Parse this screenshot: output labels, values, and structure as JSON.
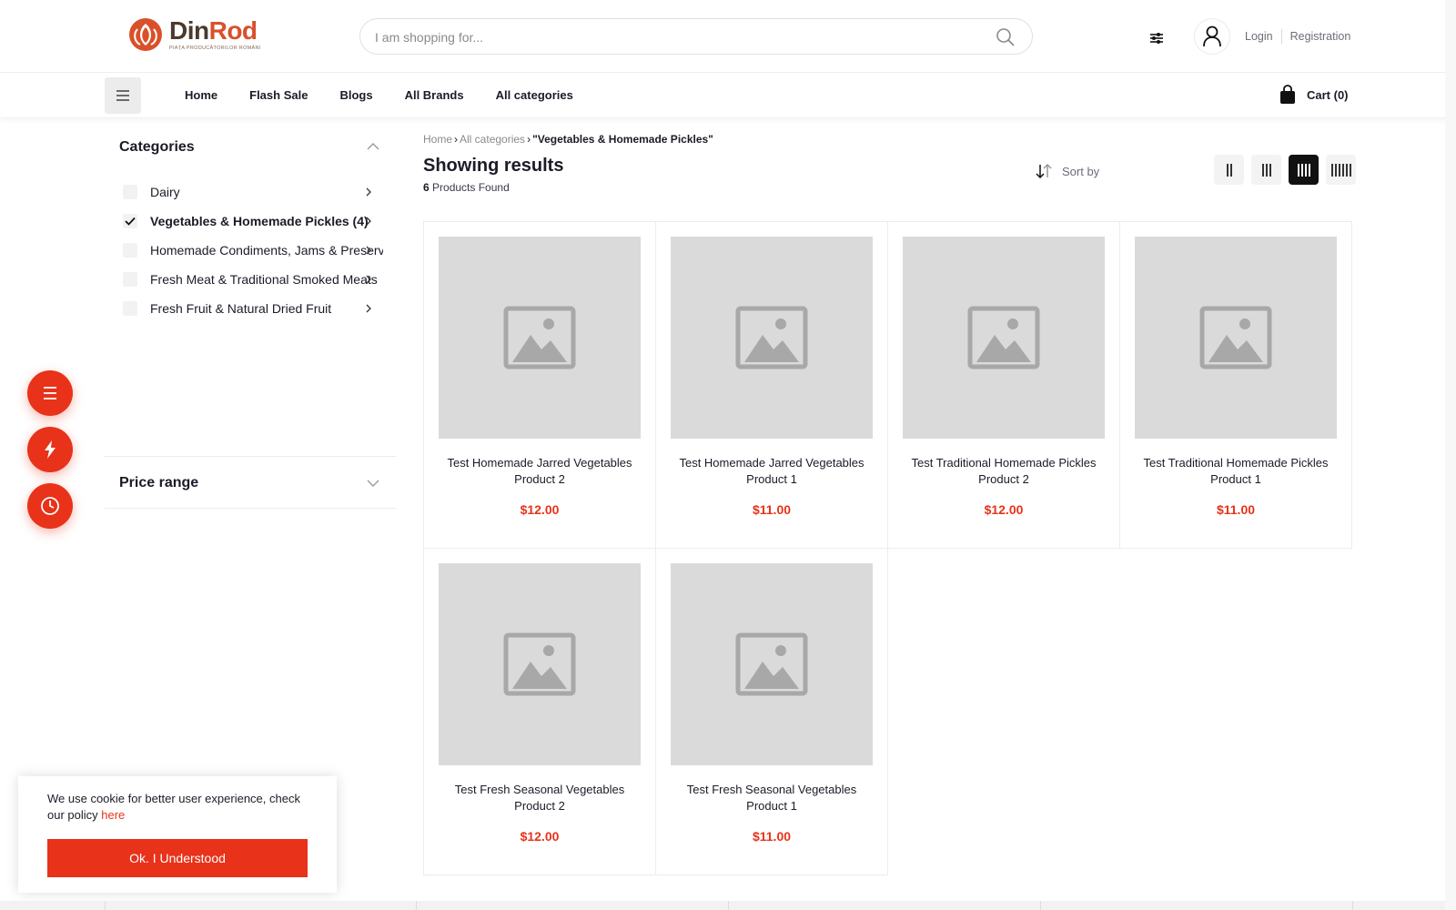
{
  "header": {
    "brand_name_a": "Din",
    "brand_name_b": "Rod",
    "brand_tagline": "PIAȚA PRODUCĂTORILOR ROMÂNI",
    "search_placeholder": "I am shopping for...",
    "login_label": "Login",
    "registration_label": "Registration"
  },
  "nav": {
    "links": [
      "Home",
      "Flash Sale",
      "Blogs",
      "All Brands",
      "All categories"
    ],
    "cart_label": "Cart (0)"
  },
  "sidebar": {
    "categories_title": "Categories",
    "categories": [
      {
        "label": "Dairy",
        "checked": false
      },
      {
        "label": "Vegetables & Homemade Pickles (4)",
        "checked": true
      },
      {
        "label": "Homemade Condiments, Jams & Preserves",
        "checked": false
      },
      {
        "label": "Fresh Meat & Traditional Smoked Meats",
        "checked": false
      },
      {
        "label": "Fresh Fruit & Natural Dried Fruit",
        "checked": false
      }
    ],
    "price_range_title": "Price range"
  },
  "breadcrumb": {
    "home": "Home",
    "all_categories": "All categories",
    "current": "\"Vegetables & Homemade Pickles\""
  },
  "results": {
    "title": "Showing results",
    "count": "6",
    "count_suffix": " Products Found",
    "sort_label": "Sort by"
  },
  "products": [
    {
      "name": "Test Homemade Jarred Vegetables Product 2",
      "price": "$12.00"
    },
    {
      "name": "Test Homemade Jarred Vegetables Product 1",
      "price": "$11.00"
    },
    {
      "name": "Test Traditional Homemade Pickles Product 2",
      "price": "$12.00"
    },
    {
      "name": "Test Traditional Homemade Pickles Product 1",
      "price": "$11.00"
    },
    {
      "name": "Test Fresh Seasonal Vegetables Product 2",
      "price": "$12.00"
    },
    {
      "name": "Test Fresh Seasonal Vegetables Product 1",
      "price": "$11.00"
    }
  ],
  "cookie": {
    "text": "We use cookie for better user experience, check our policy ",
    "link": "here",
    "button": "Ok. I Understood"
  },
  "colors": {
    "accent": "#e8321a",
    "brand_brown": "#4a3a2e",
    "placeholder_gray": "#dadada"
  }
}
